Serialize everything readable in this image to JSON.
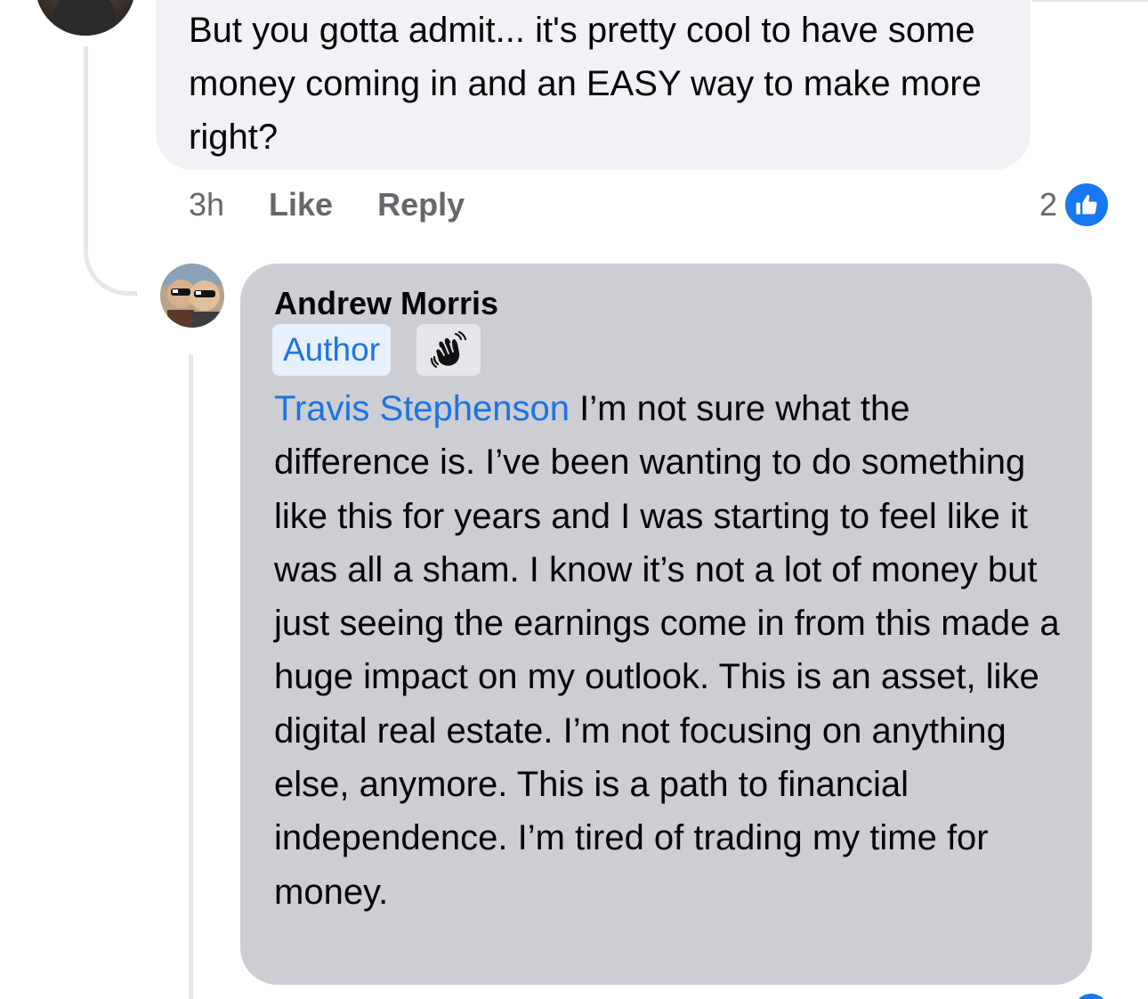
{
  "comment_top": {
    "text": "But you gotta admit... it's pretty cool to have some money coming in and an EASY way to make more right?",
    "time": "3h",
    "like_label": "Like",
    "reply_label": "Reply",
    "reaction_count": "2",
    "reaction_icon": "thumbs-up-icon"
  },
  "comment_reply": {
    "author": "Andrew Morris",
    "author_badge": "Author",
    "badge_icon": "waving-hand-icon",
    "mention": "Travis Stephenson",
    "text": " I’m not sure what the difference is. I’ve been wanting to do something like this for years and I was starting to feel like it was all a sham. I know it’s not a lot of money but just seeing the earnings come in from this made a huge impact on my outlook. This is an asset, like digital real estate. I’m not focusing on anything else, anymore. This is a path to financial independence. I’m tired of trading my time for money."
  },
  "colors": {
    "accent": "#1b74e4",
    "like_blue": "#1877f2",
    "bubble_light": "#f0f2f5",
    "bubble_highlight": "#ccced3",
    "meta_text": "#65676b"
  }
}
